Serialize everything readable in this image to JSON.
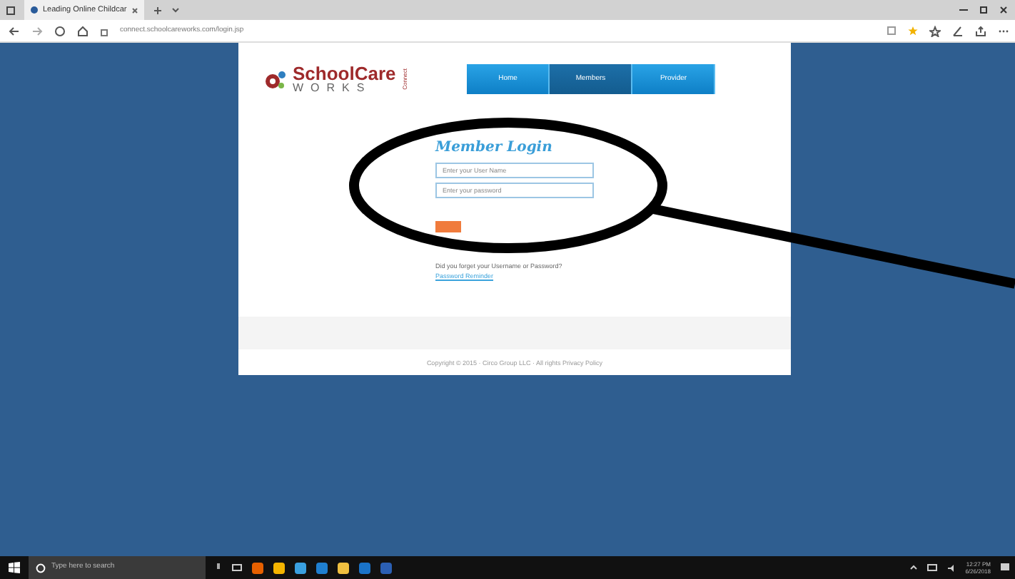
{
  "browser": {
    "tabs": [
      {
        "title": "Leading Online Childcar",
        "selected": true
      }
    ],
    "address": "connect.schoolcareworks.com/login.jsp"
  },
  "site": {
    "logo": {
      "name": "SchoolCare",
      "sub": "WORKS",
      "tag": "Connect"
    },
    "nav": [
      {
        "label": "Home",
        "selected": false
      },
      {
        "label": "Members",
        "selected": true
      },
      {
        "label": "Provider",
        "selected": false
      }
    ],
    "login": {
      "title": "Member Login",
      "fields": [
        {
          "placeholder": "Enter your User Name"
        },
        {
          "placeholder": "Enter your password"
        }
      ],
      "forgot": "Did you forget your Username or Password?",
      "reminder_link": "Password Reminder"
    },
    "footer": "Copyright © 2015 · Circo Group LLC · All rights Privacy Policy"
  },
  "taskbar": {
    "search_placeholder": "Type here to search",
    "time": "12:27 PM",
    "date": "6/26/2018"
  }
}
